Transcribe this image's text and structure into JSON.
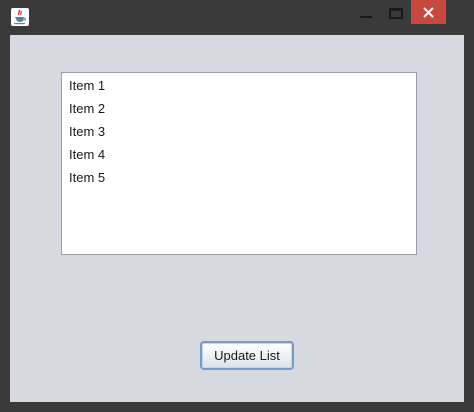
{
  "window": {
    "minimize_icon": "minimize-icon",
    "maximize_icon": "maximize-icon",
    "close_icon": "close-icon",
    "close_color": "#c7483f"
  },
  "list": {
    "items": [
      "Item 1",
      "Item 2",
      "Item 3",
      "Item 4",
      "Item 5"
    ]
  },
  "button": {
    "label": "Update List"
  }
}
